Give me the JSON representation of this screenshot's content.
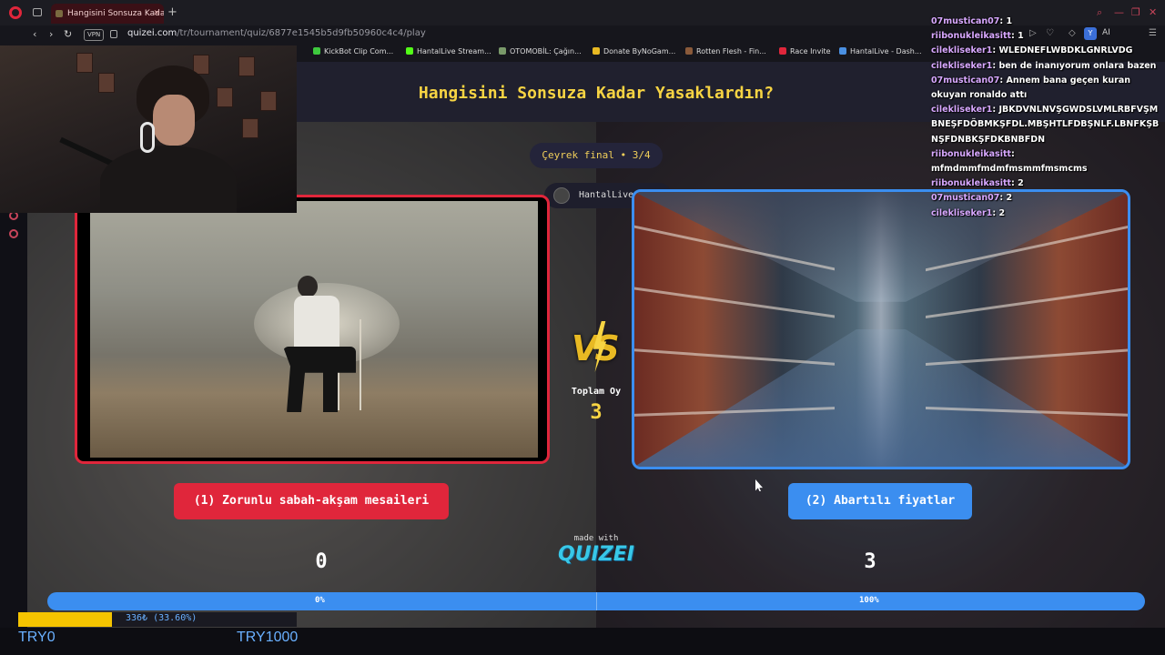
{
  "browser": {
    "tab_title": "Hangisini Sonsuza Kadar Y",
    "url_domain": "quizei.com",
    "url_path": "/tr/tournament/quiz/6877e1545b5d9fb50960c4c4/play",
    "vpn_label": "VPN",
    "ai_label": "AI"
  },
  "bookmarks": [
    {
      "label": "KickBot Clip Com...",
      "color": "#3ec93e"
    },
    {
      "label": "HantalLive Stream...",
      "color": "#53fc18"
    },
    {
      "label": "OTOMOBİL: Çağın...",
      "color": "#7a9a6a"
    },
    {
      "label": "Donate ByNoGam...",
      "color": "#e8b923"
    },
    {
      "label": "Rotten Flesh - Fin...",
      "color": "#8a5a3a"
    },
    {
      "label": "Race Invite",
      "color": "#e0263b"
    },
    {
      "label": "HantalLive - Dash...",
      "color": "#4a90e2"
    }
  ],
  "quiz": {
    "title": "Hangisini Sonsuza Kadar Yasaklardın?",
    "round": "Çeyrek final • 3/4",
    "creator": "HantalLive",
    "vs_text": "VS",
    "total_label": "Toplam Oy",
    "total_votes": "3",
    "made_with": "made with",
    "brand": "QUIZEI",
    "option1": {
      "label": "(1) Zorunlu sabah-akşam mesaileri",
      "votes": "0",
      "percent": "0%",
      "accent": "#e0263b"
    },
    "option2": {
      "label": "(2) Abartılı fiyatlar",
      "votes": "3",
      "percent": "100%",
      "accent": "#3b8ef0"
    }
  },
  "chat": [
    {
      "user": "07mustican07",
      "msg": "1"
    },
    {
      "user": "riibonukleikasitt",
      "msg": "1"
    },
    {
      "user": "cilekliseker1",
      "msg": "WLEDNEFLWBDKLGNRLVDG"
    },
    {
      "user": "cilekliseker1",
      "msg": "ben de inanıyorum onlara bazen"
    },
    {
      "user": "07mustican07",
      "msg": "Annem bana geçen kuran okuyan ronaldo attı"
    },
    {
      "user": "cilekliseker1",
      "msg": "JBKDVNLNVŞGWDSLVMLRBFVŞMBNEŞFDÖBMKŞFDL.MBŞHTLFDBŞNLF.LBNFKŞBNŞFDNBKŞFDKBNBFDN"
    },
    {
      "user": "riibonukleikasitt",
      "msg": "mfmdmmfmdmfmsmmfmsmcms"
    },
    {
      "user": "riibonukleikasitt",
      "msg": "2"
    },
    {
      "user": "07mustican07",
      "msg": "2"
    },
    {
      "user": "cilekliseker1",
      "msg": "2"
    }
  ],
  "stream_overlay": {
    "goal_text": "336₺ (33.60%)",
    "goal_progress": 0.336,
    "min_label": "TRY0",
    "max_label": "TRY1000",
    "goal_color": "#f5c400"
  }
}
